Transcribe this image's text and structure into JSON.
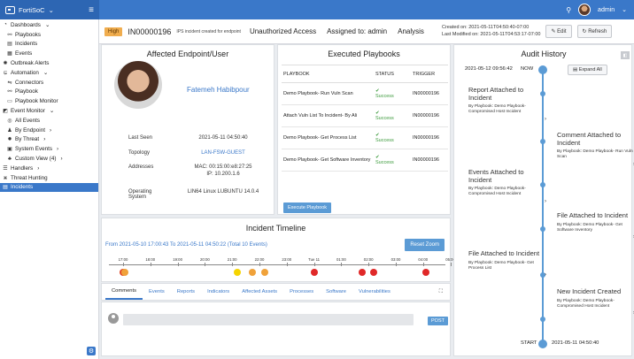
{
  "app": {
    "brand": "FortiSoC",
    "admin": "admin"
  },
  "sidebar": {
    "items": [
      {
        "label": "Dashboards",
        "icon": "dashboard-icon",
        "level": 0,
        "arrow": "⌄"
      },
      {
        "label": "Playbooks",
        "icon": "playbook-icon",
        "level": 1
      },
      {
        "label": "Incidents",
        "icon": "incident-icon",
        "level": 1
      },
      {
        "label": "Events",
        "icon": "event-icon",
        "level": 1
      },
      {
        "label": "Outbreak Alerts",
        "icon": "alert-icon",
        "level": 0
      },
      {
        "label": "Automation",
        "icon": "automation-icon",
        "level": 0,
        "arrow": "⌄"
      },
      {
        "label": "Connectors",
        "icon": "connector-icon",
        "level": 1
      },
      {
        "label": "Playbook",
        "icon": "playbook-icon",
        "level": 1
      },
      {
        "label": "Playbook Monitor",
        "icon": "monitor-icon",
        "level": 1
      },
      {
        "label": "Event Monitor",
        "icon": "event-monitor-icon",
        "level": 0,
        "arrow": "⌄"
      },
      {
        "label": "All Events",
        "icon": "all-events-icon",
        "level": 1
      },
      {
        "label": "By Endpoint",
        "icon": "endpoint-icon",
        "level": 1,
        "arrow": "›"
      },
      {
        "label": "By Threat",
        "icon": "threat-icon",
        "level": 1,
        "arrow": "›"
      },
      {
        "label": "System Events",
        "icon": "system-icon",
        "level": 1,
        "arrow": "›"
      },
      {
        "label": "Custom View (4)",
        "icon": "custom-view-icon",
        "level": 1,
        "arrow": "›"
      },
      {
        "label": "Handlers",
        "icon": "handler-icon",
        "level": 0,
        "arrow": "›"
      },
      {
        "label": "Threat Hunting",
        "icon": "hunting-icon",
        "level": 0
      },
      {
        "label": "Incidents",
        "icon": "incident-icon",
        "level": 0,
        "active": true
      }
    ]
  },
  "header": {
    "severity": "High",
    "id": "IN00000196",
    "desc": "IPS incident created for endpoint",
    "name": "Unauthorized Access",
    "assigned": "Assigned to: admin",
    "phase": "Analysis",
    "created": "Created on: 2021-05-11T04:50:40-07:00",
    "modified": "Last Modified on: 2021-05-11T04:53:17-07:00",
    "edit": "Edit",
    "refresh": "Refresh"
  },
  "endpoint": {
    "title": "Affected Endpoint/User",
    "name": "Fatemeh Habibpour",
    "rows": [
      {
        "k": "Last Seen",
        "v": "2021-05-11 04:50:40"
      },
      {
        "k": "Topology",
        "v": "LAN-FSW-GUEST"
      },
      {
        "k": "Addresses",
        "v": "MAC: 00:15:00:e8:27:25",
        "v2": "IP: 10.200.1.6"
      },
      {
        "k": "Operating System",
        "v": "LIN64 Linux LUBUNTU 14.0.4"
      }
    ]
  },
  "playbooks": {
    "title": "Executed Playbooks",
    "headers": [
      "PLAYBOOK",
      "STATUS",
      "TRIGGER"
    ],
    "rows": [
      {
        "name": "Demo Playbook- Run Vuln Scan",
        "status": "Success",
        "trigger": "IN00000196"
      },
      {
        "name": "Attach Vuln List To Incident- By Ali",
        "status": "Success",
        "trigger": "IN00000196"
      },
      {
        "name": "Demo Playbook- Get Process List",
        "status": "Success",
        "trigger": "IN00000196"
      },
      {
        "name": "Demo Playbook- Get Software Inventory",
        "status": "Success",
        "trigger": "IN00000196"
      }
    ],
    "execute": "Execute Playbook"
  },
  "timeline": {
    "title": "Incident Timeline",
    "range": "From 2021-05-10 17:00:43 To 2021-05-11 04:50:22 (Total 10 Events)",
    "reset": "Reset Zoom",
    "ticks": [
      "17:00",
      "18:00",
      "19:00",
      "20:00",
      "21:00",
      "22:00",
      "23:00",
      "Tue 11",
      "01:00",
      "02:00",
      "03:00",
      "04:00",
      "05:00"
    ],
    "events": [
      {
        "hour": 0.0,
        "color": "#e24a2a"
      },
      {
        "hour": 0.05,
        "color": "#f0a23a"
      },
      {
        "hour": 4.2,
        "color": "#f5d400"
      },
      {
        "hour": 4.75,
        "color": "#f0a23a"
      },
      {
        "hour": 5.2,
        "color": "#f0a23a"
      },
      {
        "hour": 7.0,
        "color": "#e02828"
      },
      {
        "hour": 8.75,
        "color": "#e02828"
      },
      {
        "hour": 9.2,
        "color": "#e02828"
      },
      {
        "hour": 11.1,
        "color": "#e02828"
      }
    ]
  },
  "tabs": [
    "Comments",
    "Events",
    "Reports",
    "Indicators",
    "Affected Assets",
    "Processes",
    "Software",
    "Vulnerabilities"
  ],
  "comments": {
    "post": "POST"
  },
  "audit": {
    "title": "Audit History",
    "now_date": "2021-05-12 09:56:42",
    "now": "NOW",
    "expand": "Expand All",
    "start": "START",
    "start_date": "2021-05-11 04:50:40",
    "entries": [
      {
        "title": "Report Attached to Incident",
        "sub": "By Playbook: Demo Playbook- Compromised Host Incident",
        "side": "left"
      },
      {
        "title": "Comment Attached to Incident",
        "sub": "By Playbook: Demo Playbook- Run Vuln Scan",
        "side": "right"
      },
      {
        "title": "Events Attached to Incident",
        "sub": "By Playbook: Demo Playbook- Compromised Host Incident",
        "side": "left"
      },
      {
        "title": "File Attached to Incident",
        "sub": "By Playbook: Demo Playbook- Get Software Inventory",
        "side": "right"
      },
      {
        "title": "File Attached to Incident",
        "sub": "By Playbook: Demo Playbook- Get Process List",
        "side": "left"
      },
      {
        "title": "New Incident Created",
        "sub": "By Playbook: Demo Playbook- Compromised Host Incident",
        "side": "right"
      }
    ]
  },
  "colors": {
    "brand": "#3a78c9",
    "accent": "#5b9bd5",
    "high": "#f0ad4e",
    "success": "#3c9a3c"
  }
}
